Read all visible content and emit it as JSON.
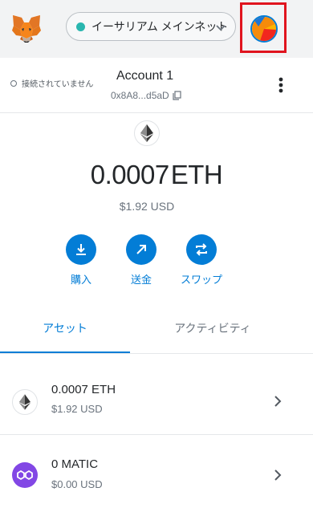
{
  "header": {
    "logo_icon": "metamask-fox-icon",
    "network": {
      "label": "イーサリアム メインネット",
      "dot_color": "#29b6af",
      "chevron_icon": "chevron-down-icon"
    },
    "account_icon": "account-avatar-icon",
    "highlight_color": "#e0141e"
  },
  "account": {
    "connection_status": "接続されていません",
    "name": "Account 1",
    "address": "0x8A8...d5aD",
    "copy_icon": "copy-icon",
    "menu_icon": "kebab-menu-icon"
  },
  "balance": {
    "token_icon": "ethereum-icon",
    "amount": "0.0007",
    "unit": "ETH",
    "fiat": "$1.92 USD"
  },
  "actions": [
    {
      "label": "購入",
      "icon": "buy-icon"
    },
    {
      "label": "送金",
      "icon": "send-icon"
    },
    {
      "label": "スワップ",
      "icon": "swap-icon"
    }
  ],
  "tabs": {
    "assets": "アセット",
    "activity": "アクティビティ",
    "active": "assets"
  },
  "assets": [
    {
      "amount": "0.0007 ETH",
      "fiat": "$1.92 USD",
      "icon": "ethereum-icon"
    },
    {
      "amount": "0 MATIC",
      "fiat": "$0.00 USD",
      "icon": "polygon-icon"
    }
  ],
  "colors": {
    "accent": "#037dd6",
    "header_bg": "#f2f3f4",
    "polygon": "#8247e5"
  }
}
